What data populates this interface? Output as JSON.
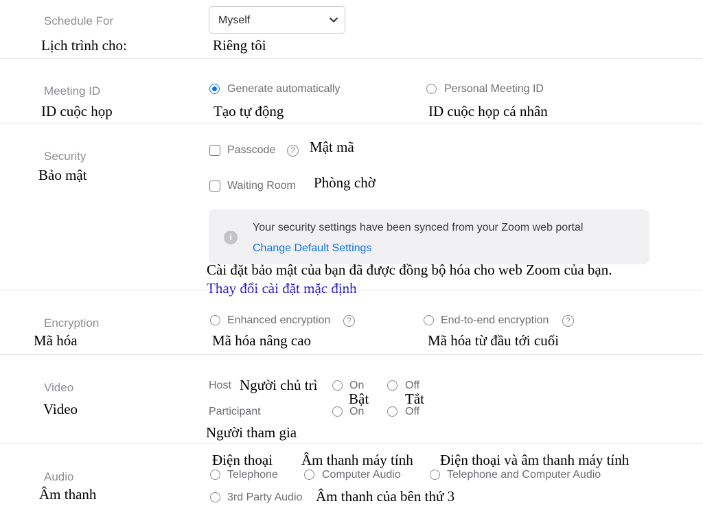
{
  "schedule": {
    "label": "Schedule For",
    "label_vi": "Lịch trình cho:",
    "selected": "Myself",
    "selected_vi": "Riêng tôi"
  },
  "meeting_id": {
    "label": "Meeting ID",
    "label_vi": "ID cuộc họp",
    "options": [
      {
        "label": "Generate automatically",
        "label_vi": "Tạo tự động",
        "checked": true
      },
      {
        "label": "Personal Meeting ID",
        "label_vi": "ID cuộc họp cá nhân",
        "checked": false
      }
    ]
  },
  "security": {
    "label": "Security",
    "label_vi": "Bảo mật",
    "passcode": {
      "label": "Passcode",
      "label_vi": "Mật mã",
      "checked": false
    },
    "waiting_room": {
      "label": "Waiting Room",
      "label_vi": "Phòng chờ",
      "checked": false
    },
    "notice": {
      "message": "Your security settings have been synced from your Zoom web portal",
      "link": "Change Default Settings",
      "message_vi": "Cài đặt bảo mật của bạn đã được đồng bộ hóa cho web Zoom của bạn.",
      "link_vi": "Thay đổi cài đặt mặc định"
    }
  },
  "encryption": {
    "label": "Encryption",
    "label_vi": "Mã hóa",
    "options": [
      {
        "label": "Enhanced encryption",
        "label_vi": "Mã hóa nâng cao",
        "checked": false
      },
      {
        "label": "End-to-end encryption",
        "label_vi": "Mã hóa từ đầu tới cuối",
        "checked": false
      }
    ]
  },
  "video": {
    "label": "Video",
    "label_vi": "Video",
    "host": {
      "label": "Host",
      "label_vi": "Người chủ trì"
    },
    "participant": {
      "label": "Participant",
      "label_vi": "Người tham gia"
    },
    "on": "On",
    "off": "Off",
    "on_vi": "Bật",
    "off_vi": "Tắt"
  },
  "audio": {
    "label": "Audio",
    "label_vi": "Âm thanh",
    "options": [
      {
        "label": "Telephone",
        "label_vi": "Điện thoại",
        "checked": false
      },
      {
        "label": "Computer Audio",
        "label_vi": "Âm thanh máy tính",
        "checked": false
      },
      {
        "label": "Telephone and Computer Audio",
        "label_vi": "Điện thoại và âm thanh máy tính",
        "checked": false
      },
      {
        "label": "3rd Party Audio",
        "label_vi": "Âm thanh của bên thứ 3",
        "checked": false
      }
    ]
  },
  "icons": {
    "help": "?",
    "info": "i"
  },
  "colors": {
    "accent": "#0e71eb",
    "label_gray": "#8e8e94",
    "annotation_link": "#1a0dd8",
    "notice_bg": "#f1f1f3"
  }
}
